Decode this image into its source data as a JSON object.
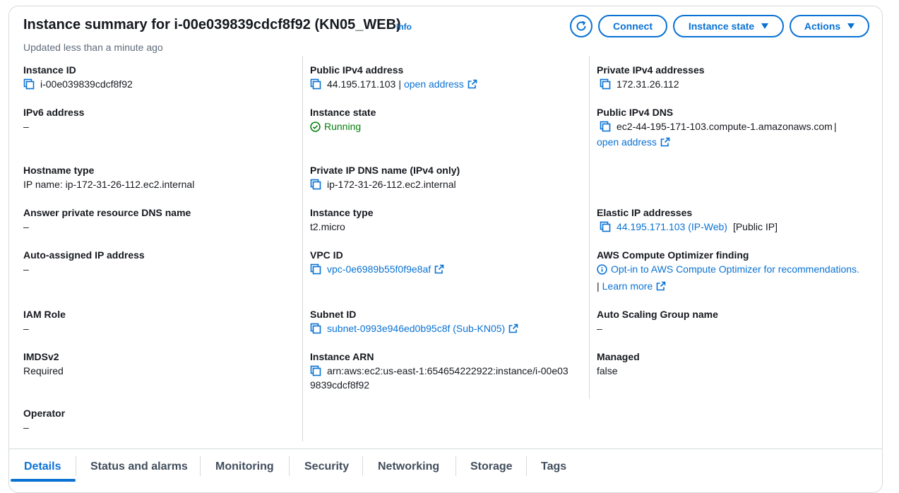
{
  "header": {
    "title": "Instance summary for i-00e039839cdcf8f92 (KN05_WEB)",
    "info": "Info",
    "updated": "Updated less than a minute ago",
    "connect": "Connect",
    "instance_state": "Instance state",
    "actions": "Actions"
  },
  "col1": {
    "instance_id_label": "Instance ID",
    "instance_id": "i-00e039839cdcf8f92",
    "ipv6_label": "IPv6 address",
    "ipv6": "–",
    "hostname_type_label": "Hostname type",
    "hostname_type": "IP name: ip-172-31-26-112.ec2.internal",
    "answer_dns_label": "Answer private resource DNS name",
    "answer_dns": "–",
    "auto_ip_label": "Auto-assigned IP address",
    "auto_ip": "–",
    "iam_label": "IAM Role",
    "iam": "–",
    "imds_label": "IMDSv2",
    "imds": "Required",
    "operator_label": "Operator",
    "operator": "–"
  },
  "col2": {
    "public_ipv4_label": "Public IPv4 address",
    "public_ipv4": "44.195.171.103",
    "public_ipv4_sep": "|",
    "open_address": "open address",
    "state_label": "Instance state",
    "state": "Running",
    "private_dns_label": "Private IP DNS name (IPv4 only)",
    "private_dns": "ip-172-31-26-112.ec2.internal",
    "type_label": "Instance type",
    "type": "t2.micro",
    "vpc_label": "VPC ID",
    "vpc": "vpc-0e6989b55f0f9e8af",
    "subnet_label": "Subnet ID",
    "subnet": "subnet-0993e946ed0b95c8f (Sub-KN05)",
    "arn_label": "Instance ARN",
    "arn_line1": "arn:aws:ec2:us-east-1:654654222922:instance/i-00e03",
    "arn_line2": "9839cdcf8f92"
  },
  "col3": {
    "private_ipv4_label": "Private IPv4 addresses",
    "private_ipv4": "172.31.26.112",
    "public_dns_label": "Public IPv4 DNS",
    "public_dns": "ec2-44-195-171-103.compute-1.amazonaws.com",
    "public_dns_sep": "|",
    "open_address": "open address",
    "elastic_label": "Elastic IP addresses",
    "elastic": "44.195.171.103 (IP-Web)",
    "elastic_tag": "[Public IP]",
    "optimizer_label": "AWS Compute Optimizer finding",
    "optimizer": "Opt-in to AWS Compute Optimizer for recommendations.",
    "learn_sep": "|",
    "learn_more": "Learn more",
    "asg_label": "Auto Scaling Group name",
    "asg": "–",
    "managed_label": "Managed",
    "managed": "false"
  },
  "tabs": [
    "Details",
    "Status and alarms",
    "Monitoring",
    "Security",
    "Networking",
    "Storage",
    "Tags"
  ],
  "colors": {
    "accent": "#0972d3",
    "success": "#037f0c",
    "text": "#16191f",
    "muted": "#5f6b7a"
  }
}
